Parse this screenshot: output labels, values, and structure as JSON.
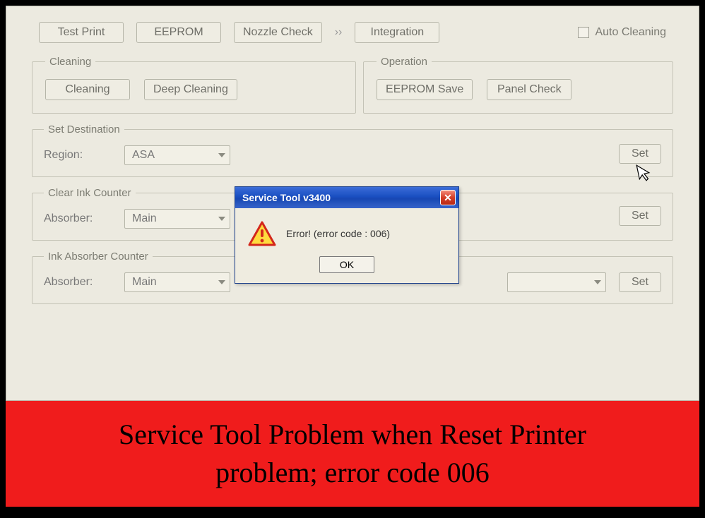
{
  "topButtons": {
    "testPrint": "Test Print",
    "eeprom": "EEPROM",
    "nozzleCheck": "Nozzle Check",
    "integration": "Integration"
  },
  "autoCleaning": {
    "label": "Auto Cleaning"
  },
  "cleaningGroup": {
    "legend": "Cleaning",
    "cleaning": "Cleaning",
    "deep": "Deep Cleaning"
  },
  "operationGroup": {
    "legend": "Operation",
    "eepromSave": "EEPROM Save",
    "panelCheck": "Panel Check"
  },
  "setDestination": {
    "legend": "Set Destination",
    "regionLabel": "Region:",
    "regionValue": "ASA",
    "setBtn": "Set"
  },
  "clearInkCounter": {
    "legend": "Clear Ink Counter",
    "absorberLabel": "Absorber:",
    "absorberValue": "Main",
    "setBtn": "Set"
  },
  "inkAbsorberCounter": {
    "legend": "Ink Absorber Counter",
    "absorberLabel": "Absorber:",
    "absorberValue": "Main",
    "setBtn": "Set"
  },
  "dialog": {
    "title": "Service Tool v3400",
    "message": "Error! (error code : 006)",
    "ok": "OK"
  },
  "banner": {
    "line1": "Service Tool Problem when Reset Printer",
    "line2": "problem; error code 006"
  }
}
